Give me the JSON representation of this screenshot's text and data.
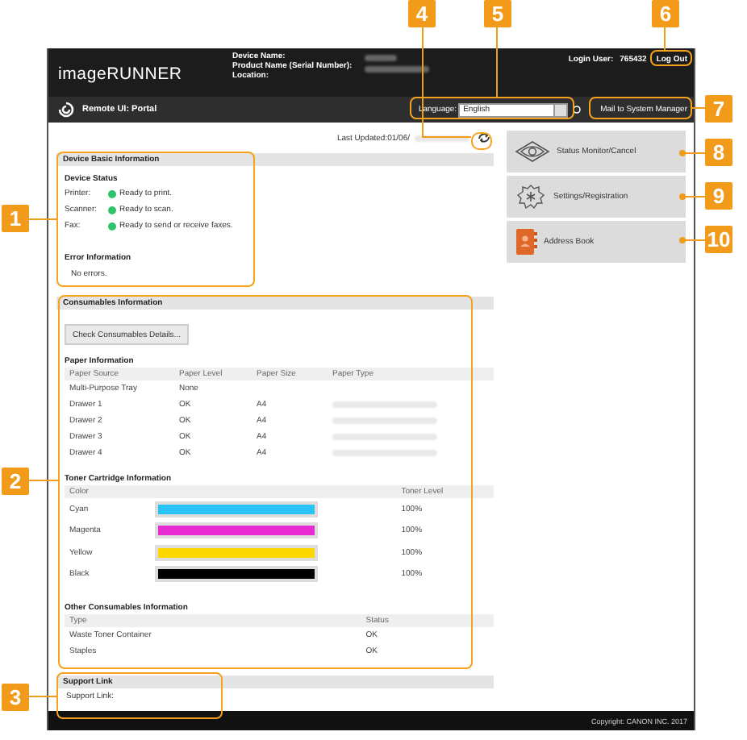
{
  "header": {
    "logo": "imageRUNNER",
    "device_fields": [
      "Device Name:",
      "Product Name (Serial Number):",
      "Location:"
    ],
    "login_user_label": "Login User:",
    "login_user": "765432",
    "logout": "Log Out"
  },
  "toolbar": {
    "title": "Remote UI: Portal",
    "language_label": "Language:",
    "language": "English",
    "mail_button": "Mail to System Manager"
  },
  "last_updated": "Last Updated:01/06/",
  "device_info": {
    "title": "Device Basic Information",
    "status_title": "Device Status",
    "statuses": [
      {
        "device": "Printer:",
        "status": "Ready to print.",
        "color": "#2fc46a"
      },
      {
        "device": "Scanner:",
        "status": "Ready to scan.",
        "color": "#2fc46a"
      },
      {
        "device": "Fax:",
        "status": "Ready to send or receive faxes.",
        "color": "#2fc46a"
      }
    ],
    "error_title": "Error Information",
    "error": "No errors."
  },
  "consumables": {
    "title": "Consumables Information",
    "details_button": "Check Consumables Details...",
    "paper": {
      "title": "Paper Information",
      "columns": [
        "Paper Source",
        "Paper Level",
        "Paper Size",
        "Paper Type"
      ],
      "rows": [
        {
          "source": "Multi-Purpose Tray",
          "level": "None",
          "size": "",
          "type_blurred": false
        },
        {
          "source": "Drawer 1",
          "level": "OK",
          "size": "A4",
          "type_blurred": true
        },
        {
          "source": "Drawer 2",
          "level": "OK",
          "size": "A4",
          "type_blurred": true
        },
        {
          "source": "Drawer 3",
          "level": "OK",
          "size": "A4",
          "type_blurred": true
        },
        {
          "source": "Drawer 4",
          "level": "OK",
          "size": "A4",
          "type_blurred": true
        }
      ]
    },
    "toner": {
      "title": "Toner Cartridge Information",
      "columns": [
        "Color",
        "Toner Level"
      ],
      "rows": [
        {
          "name": "Cyan",
          "color": "#2bc3f3",
          "level": 1,
          "reading": "100%"
        },
        {
          "name": "Magenta",
          "color": "#e82bd0",
          "level": 1,
          "reading": "100%"
        },
        {
          "name": "Yellow",
          "color": "#fcd800",
          "level": 1,
          "reading": "100%"
        },
        {
          "name": "Black",
          "color": "#000000",
          "level": 1,
          "reading": "100%"
        }
      ]
    },
    "other": {
      "title": "Other Consumables Information",
      "columns": [
        "Type",
        "Status"
      ],
      "rows": [
        {
          "type": "Waste Toner Container",
          "status": "OK"
        },
        {
          "type": "Staples",
          "status": "OK"
        }
      ]
    }
  },
  "support": {
    "title": "Support Link",
    "label": "Support Link:"
  },
  "menu": [
    {
      "label": "Status Monitor/Cancel",
      "kind": "eye"
    },
    {
      "label": "Settings/Registration",
      "kind": "gear"
    },
    {
      "label": "Address Book",
      "kind": "book"
    }
  ],
  "footer": "Copyright: CANON INC. 2017",
  "callouts": [
    {
      "label": "1"
    },
    {
      "label": "2"
    },
    {
      "label": "3"
    },
    {
      "label": "4"
    },
    {
      "label": "5"
    },
    {
      "label": "6"
    },
    {
      "label": "7"
    },
    {
      "label": "8"
    },
    {
      "label": "9"
    },
    {
      "label": "10"
    }
  ]
}
